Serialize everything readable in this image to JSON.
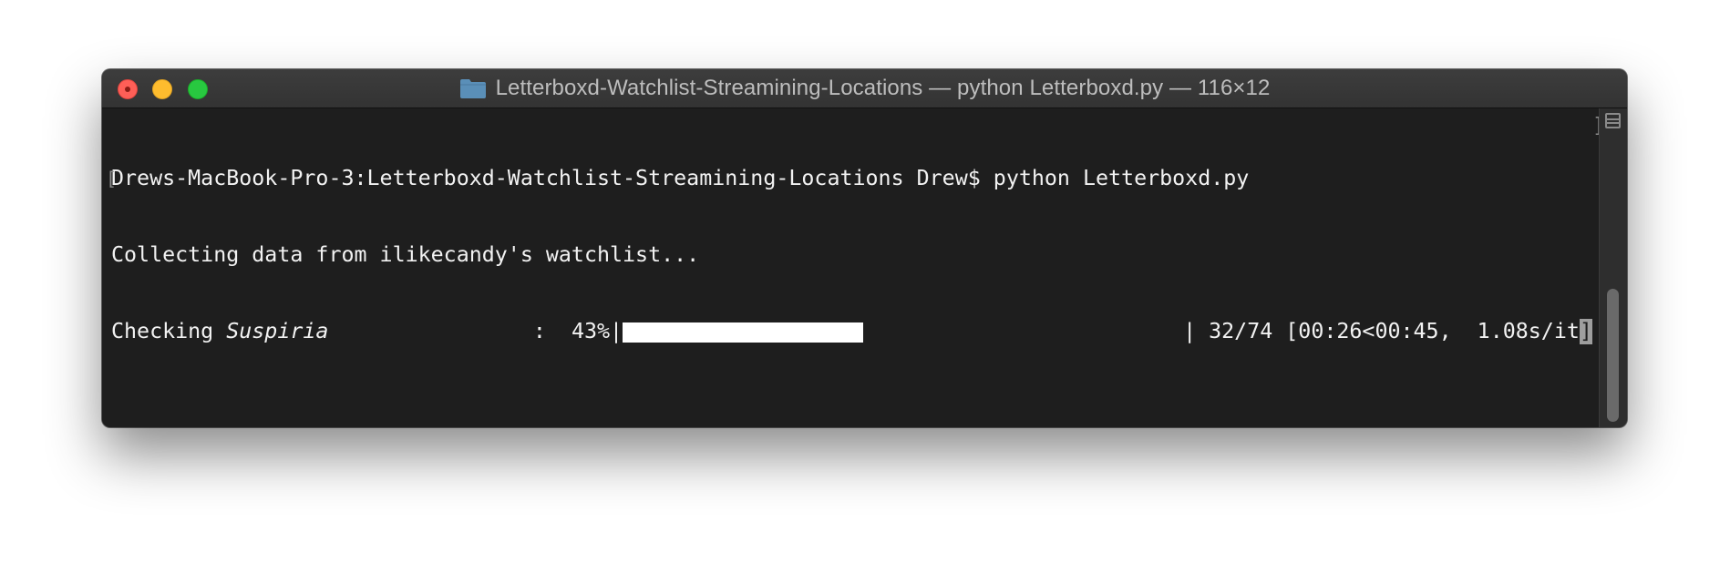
{
  "window": {
    "title": "Letterboxd-Watchlist-Streamining-Locations — python Letterboxd.py — 116×12",
    "folder_icon": "folder-icon",
    "traffic_lights": {
      "close": "#fe5f57",
      "minimize": "#febc2e",
      "maximize": "#28c840"
    }
  },
  "terminal": {
    "prompt_line": "Drews-MacBook-Pro-3:Letterboxd-Watchlist-Streamining-Locations Drew$ python Letterboxd.py",
    "collecting_line": "Collecting data from ilikecandy's watchlist...",
    "progress": {
      "prefix": "Checking ",
      "film": "Suspiria",
      "separator": "                :  ",
      "percent_text": "43%",
      "fraction": 0.43,
      "stats_text": " 32/74 [00:26<00:45,  1.08s/it",
      "end_bracket": "]"
    },
    "background": "#1e1e1e",
    "foreground": "#f2f2f2"
  },
  "scrollbar": {
    "split_icon": "split-pane-icon"
  }
}
